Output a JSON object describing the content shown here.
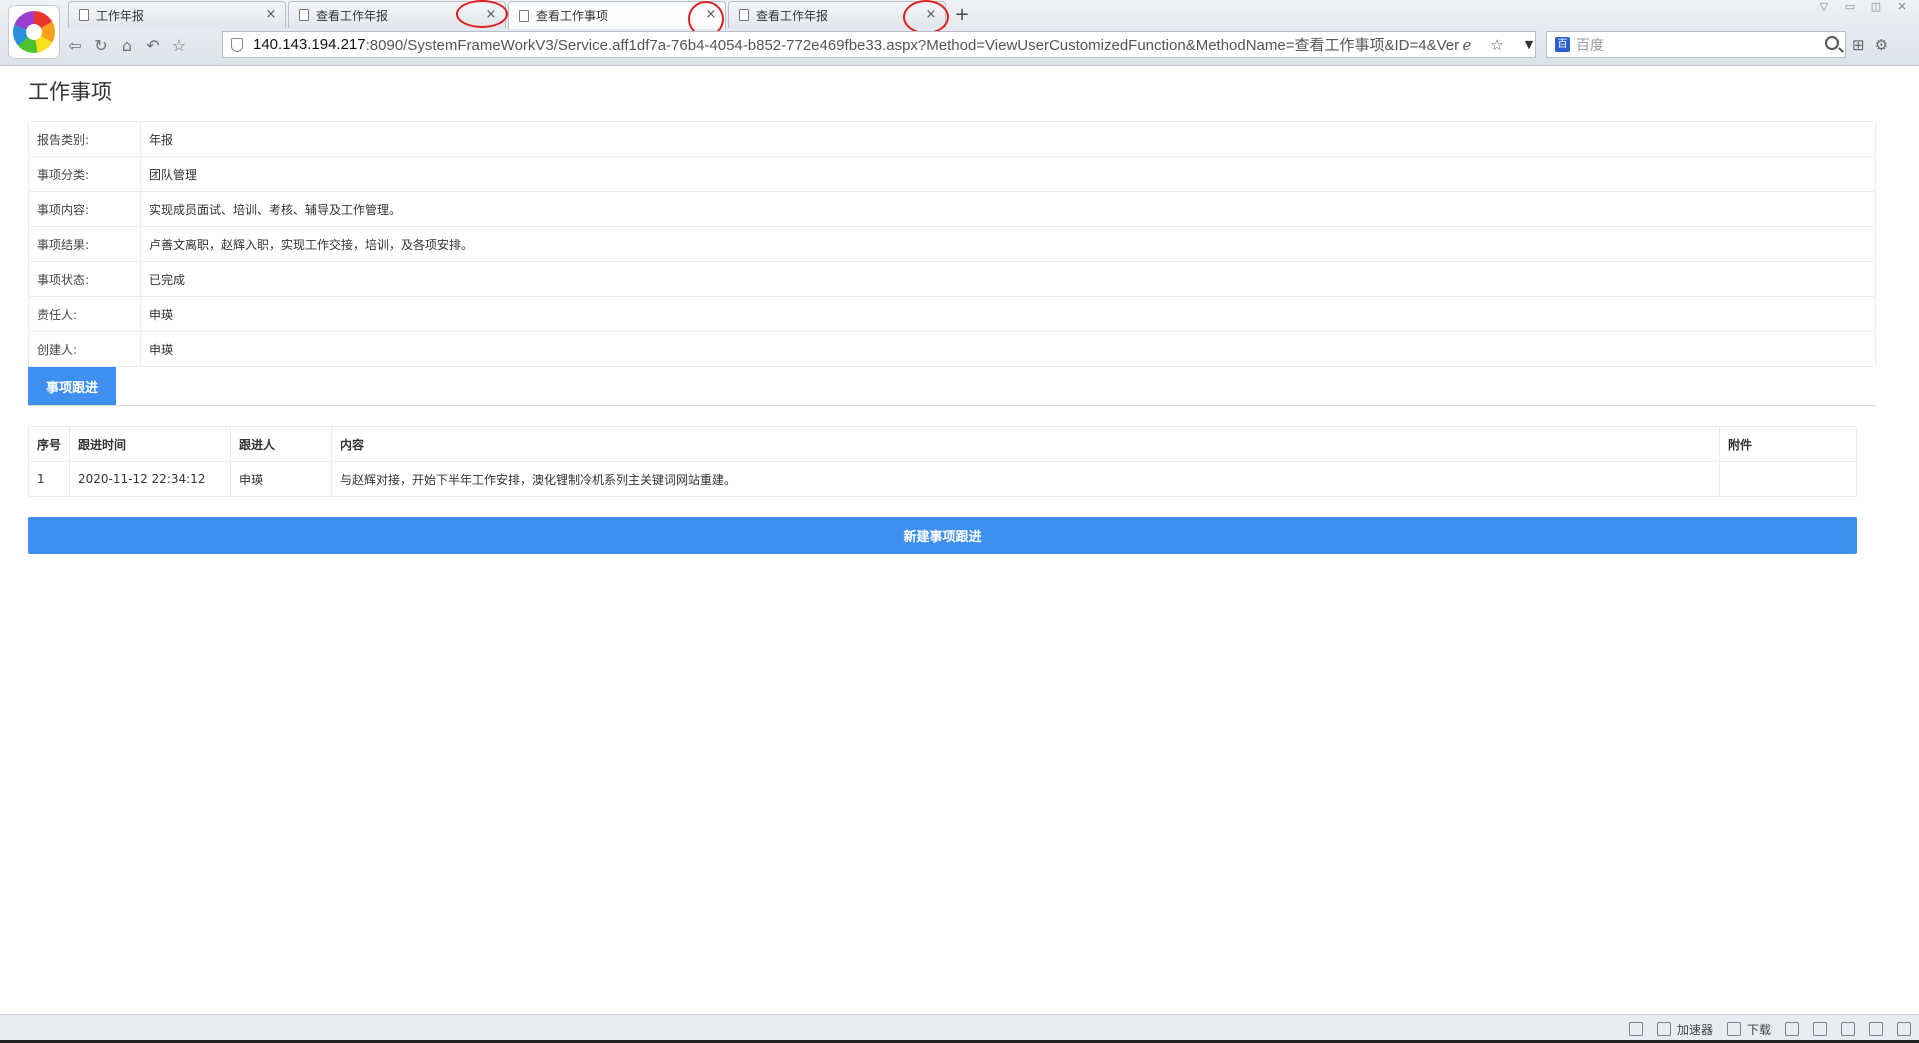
{
  "browser": {
    "tabs": [
      {
        "label": "工作年报",
        "close": "×"
      },
      {
        "label": "查看工作年报",
        "close": "×"
      },
      {
        "label": "查看工作事项",
        "close": "×"
      },
      {
        "label": "查看工作年报",
        "close": "×"
      }
    ],
    "new_tab": "+",
    "address": {
      "host": "140.143.194.217",
      "rest": ":8090/SystemFrameWorkV3/Service.aff1df7a-76b4-4054-b852-772e469fbe33.aspx?Method=ViewUserCustomizedFunction&MethodName=查看工作事项&ID=4&Ver"
    },
    "search_placeholder": "百度"
  },
  "page": {
    "title": "工作事项",
    "fields": [
      {
        "label": "报告类别:",
        "value": "年报"
      },
      {
        "label": "事项分类:",
        "value": "团队管理"
      },
      {
        "label": "事项内容:",
        "value": "实现成员面试、培训、考核、辅导及工作管理。"
      },
      {
        "label": "事项结果:",
        "value": "卢善文离职，赵辉入职，实现工作交接，培训，及各项安排。"
      },
      {
        "label": "事项状态:",
        "value": "已完成"
      },
      {
        "label": "责任人:",
        "value": "申瑛"
      },
      {
        "label": "创建人:",
        "value": "申瑛"
      }
    ],
    "subtab_label": "事项跟进",
    "follow_table": {
      "headers": [
        "序号",
        "跟进时间",
        "跟进人",
        "内容",
        "附件"
      ],
      "rows": [
        [
          "1",
          "2020-11-12 22:34:12",
          "申瑛",
          "与赵辉对接，开始下半年工作安排，澳化锂制冷机系列主关键词网站重建。",
          ""
        ]
      ]
    },
    "new_follow_button": "新建事项跟进"
  },
  "statusbar": {
    "accelerator": "加速器",
    "download": "下载"
  },
  "colors": {
    "accent": "#3f8ff1",
    "annotation": "#e02020"
  }
}
